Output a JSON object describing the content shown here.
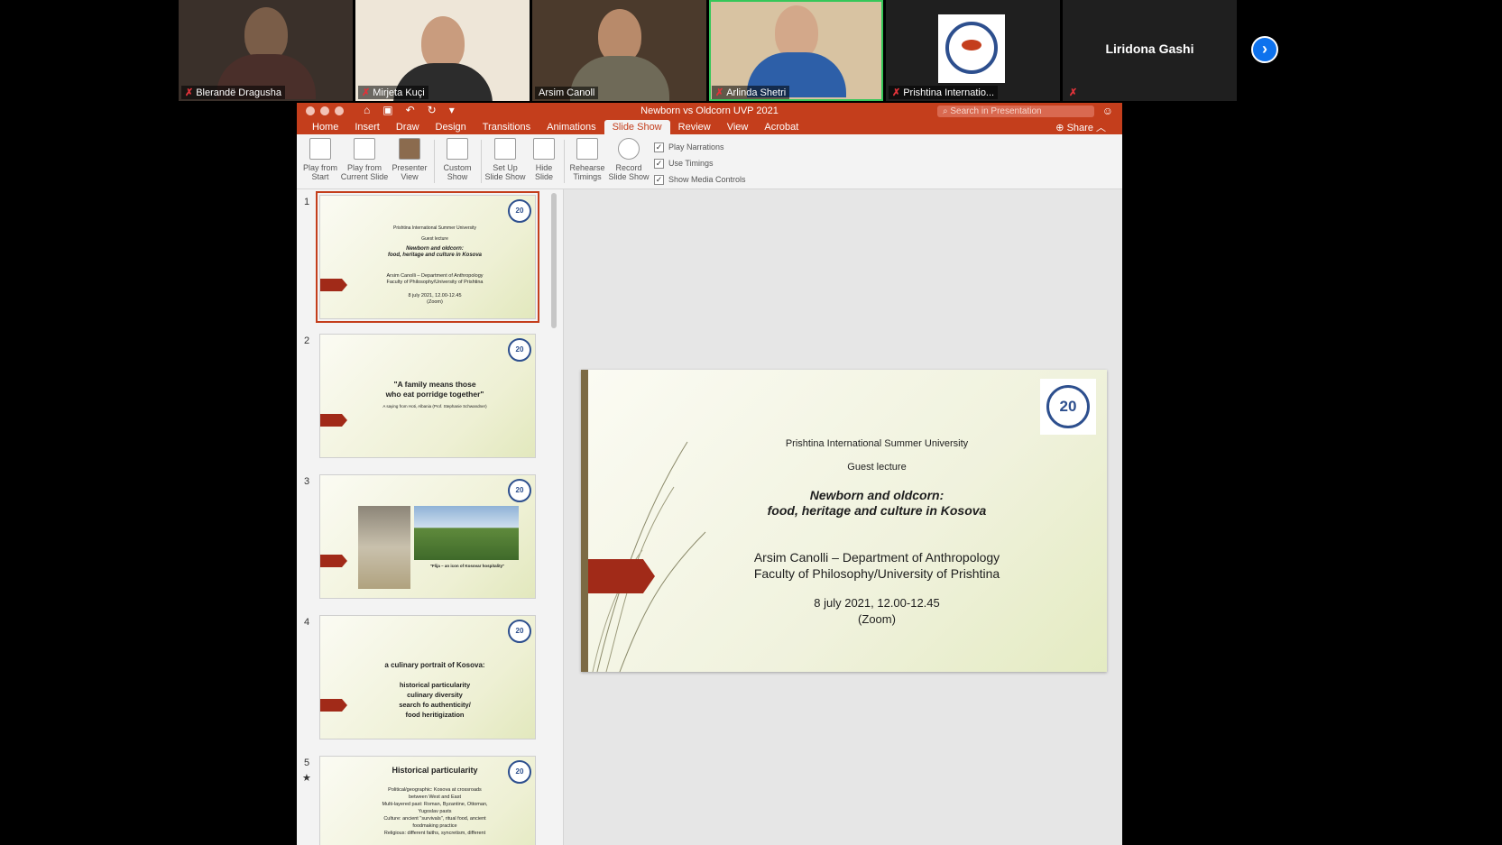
{
  "participants": [
    {
      "name": "Blerandë Dragusha",
      "muted": true
    },
    {
      "name": "Mirjeta Kuçi",
      "muted": true
    },
    {
      "name": "Arsim Canoll",
      "muted": false
    },
    {
      "name": "Arlinda Shetri",
      "muted": true
    },
    {
      "name": "Prishtina Internatio...",
      "muted": true
    },
    {
      "name": "Liridona Gashi",
      "muted": true
    }
  ],
  "icons": {
    "mic": "muted-mic-icon",
    "next": "chevron-right-icon"
  },
  "ppt": {
    "title": "Newborn vs Oldcorn UVP 2021",
    "search_placeholder": "Search in Presentation",
    "share": "Share",
    "tabs": [
      "Home",
      "Insert",
      "Draw",
      "Design",
      "Transitions",
      "Animations",
      "Slide Show",
      "Review",
      "View",
      "Acrobat"
    ],
    "active_tab": "Slide Show",
    "ribbon": {
      "play_start": [
        "Play from",
        "Start"
      ],
      "play_current": [
        "Play from",
        "Current Slide"
      ],
      "presenter": [
        "Presenter",
        "View"
      ],
      "custom": [
        "Custom",
        "Show"
      ],
      "setup": [
        "Set Up",
        "Slide Show"
      ],
      "hide": [
        "Hide",
        "Slide"
      ],
      "rehearse": [
        "Rehearse",
        "Timings"
      ],
      "record": [
        "Record",
        "Slide Show"
      ],
      "checks": [
        "Play Narrations",
        "Use Timings",
        "Show Media Controls"
      ]
    },
    "accent_color": "#c43e1c"
  },
  "thumbnails": [
    {
      "num": "1",
      "lines": [
        "Prishtina International Summer University",
        "Guest lecture",
        "Newborn and oldcorn:",
        "food, heritage and culture in Kosova",
        "Arsim Canolli – Department of Anthropology",
        "Faculty of Philosophy/University of Prishtina",
        "8 july 2021, 12.00-12.45",
        "(Zoom)"
      ]
    },
    {
      "num": "2",
      "lines": [
        "\"A family means those",
        "who eat porridge together\"",
        "A saying from Hoti, Albania (Prof. Stephanie Schwandner)"
      ]
    },
    {
      "num": "3",
      "lines": [
        "\"Flija – an icon of Kosovar hospitality\""
      ]
    },
    {
      "num": "4",
      "lines": [
        "a culinary portrait of Kosova:",
        "historical particularity",
        "culinary diversity",
        "search fo authenticity/",
        "food heritigization"
      ]
    },
    {
      "num": "5",
      "lines": [
        "Historical particularity",
        "Political/geographic: Kosova at crossroads",
        "between West and East",
        "Multi-layered past: Roman, Byzantine, Ottoman,",
        "Yugoslav pasts",
        "Culture: ancient \"survivals\", ritual food, ancient",
        "foodmaking practice",
        "Religious: different faiths, syncretism, different"
      ]
    }
  ],
  "slide": {
    "logo_text": "20",
    "line1": "Prishtina International Summer University",
    "line2": "Guest lecture",
    "title1": "Newborn and oldcorn:",
    "title2": "food, heritage and culture in Kosova",
    "author1": "Arsim Canolli – Department of Anthropology",
    "author2": "Faculty of Philosophy/University of Prishtina",
    "date": "8 july 2021, 12.00-12.45",
    "venue": "(Zoom)"
  }
}
